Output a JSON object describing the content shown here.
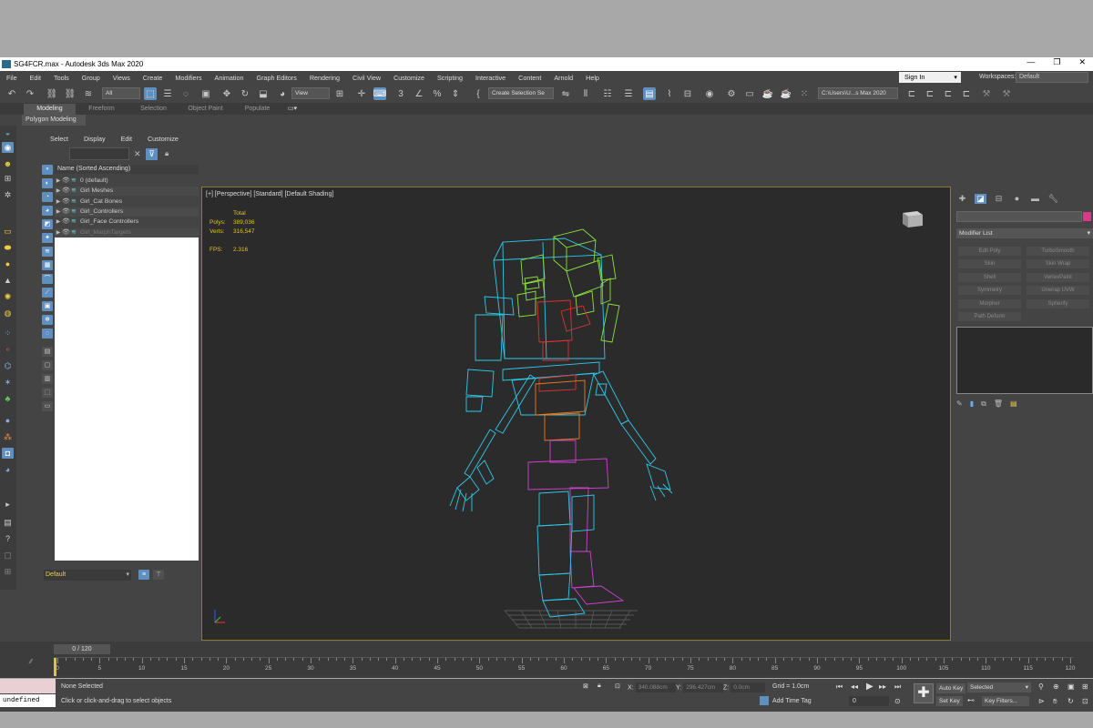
{
  "window": {
    "title": "SG4FCR.max - Autodesk 3ds Max 2020",
    "controls": [
      "—",
      "❐",
      "✕"
    ]
  },
  "menubar": {
    "items": [
      "File",
      "Edit",
      "Tools",
      "Group",
      "Views",
      "Create",
      "Modifiers",
      "Animation",
      "Graph Editors",
      "Rendering",
      "Civil View",
      "Customize",
      "Scripting",
      "Interactive",
      "Content",
      "Arnold",
      "Help"
    ],
    "sign_in": "Sign In",
    "workspaces_label": "Workspaces:",
    "workspace": "Default"
  },
  "toolbar": {
    "filter": "All",
    "ref_coord": "View",
    "selection_set": "Create Selection Se",
    "path": "C:\\Users\\U...s Max 2020"
  },
  "ribbon": {
    "tabs": [
      "Modeling",
      "Freeform",
      "Selection",
      "Object Paint",
      "Populate"
    ],
    "sub": "Polygon Modeling"
  },
  "explorer": {
    "menu": [
      "Select",
      "Display",
      "Edit",
      "Customize"
    ],
    "header": "Name (Sorted Ascending)",
    "rows": [
      {
        "label": "0 (default)",
        "dim": false
      },
      {
        "label": "Girl Meshes",
        "dim": false
      },
      {
        "label": "Girl_Cat Bones",
        "dim": false
      },
      {
        "label": "Girl_Controllers",
        "dim": false
      },
      {
        "label": "Girl_Face Controllers",
        "dim": false
      },
      {
        "label": "Girl_MarphTargets",
        "dim": true
      }
    ],
    "layer": "Default"
  },
  "viewport": {
    "label": "[+] [Perspective] [Standard] [Default Shading]",
    "stats": {
      "total_label": "Total",
      "polys_label": "Polys:",
      "polys": "389,036",
      "verts_label": "Verts:",
      "verts": "316,547",
      "fps_label": "FPS:",
      "fps": "2.316"
    }
  },
  "command_panel": {
    "modifier_list": "Modifier List",
    "buttons": [
      "Edit Poly",
      "TurboSmooth",
      "Skin",
      "Skin Wrap",
      "Shell",
      "VertexPaint",
      "Symmetry",
      "Unwrap UVW",
      "Morpher",
      "Spherify",
      "Path Deform"
    ],
    "color": "#e0368a"
  },
  "timeline": {
    "frame": "0 / 120",
    "ticks": [
      "0",
      "5",
      "10",
      "15",
      "20",
      "25",
      "30",
      "35",
      "40",
      "45",
      "50",
      "55",
      "60",
      "65",
      "70",
      "75",
      "80",
      "85",
      "90",
      "95",
      "100",
      "105",
      "110",
      "115",
      "120"
    ]
  },
  "status": {
    "script_output": "undefined",
    "selection": "None Selected",
    "prompt": "Click or click-and-drag to select objects",
    "x_label": "X:",
    "x": "340.088cm",
    "y_label": "Y:",
    "y": "296.427cm",
    "z_label": "Z:",
    "z": "0.0cm",
    "grid": "Grid = 1.0cm",
    "add_time_tag": "Add Time Tag",
    "current_frame": "0",
    "auto_key": "Auto Key",
    "set_key": "Set Key",
    "key_mode": "Selected",
    "key_filters": "Key Filters..."
  }
}
